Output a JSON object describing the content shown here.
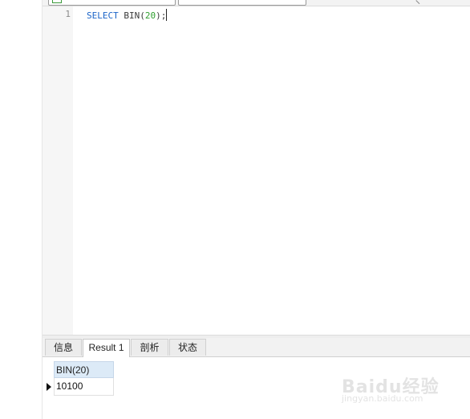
{
  "toolbar": {
    "dropdown_1_value": "",
    "dropdown_2_value": ""
  },
  "editor": {
    "lines": [
      {
        "number": "1",
        "tokens": [
          {
            "text": "SELECT",
            "kind": "keyword"
          },
          {
            "text": " BIN(",
            "kind": "function"
          },
          {
            "text": "20",
            "kind": "number"
          },
          {
            "text": ");",
            "kind": "punct"
          }
        ]
      }
    ]
  },
  "results": {
    "tabs": [
      {
        "label": "信息"
      },
      {
        "label": "Result 1",
        "active": true
      },
      {
        "label": "剖析"
      },
      {
        "label": "状态"
      }
    ],
    "grid": {
      "columns": [
        "BIN(20)"
      ],
      "rows": [
        [
          "10100"
        ]
      ]
    }
  },
  "watermark": {
    "logo_text": "Baidu经验",
    "url_text": "jingyan.baidu.com"
  },
  "colors": {
    "keyword": "#1b64c8",
    "number": "#2f9e2f",
    "header_bg": "#dceaf7"
  }
}
